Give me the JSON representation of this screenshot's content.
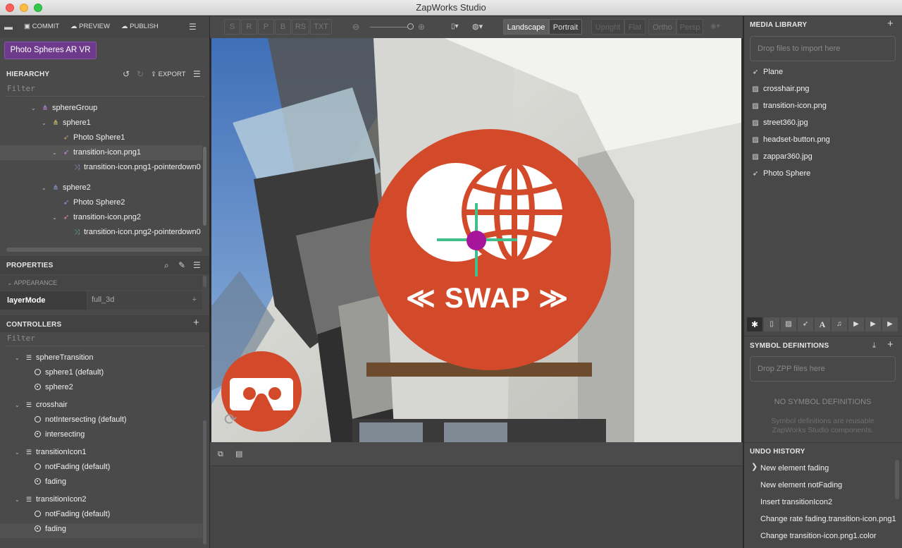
{
  "window": {
    "title": "ZapWorks Studio"
  },
  "topbar": {
    "commit": "COMMIT",
    "preview": "PREVIEW",
    "publish": "PUBLISH"
  },
  "project": {
    "name": "Photo Spheres AR VR"
  },
  "hierarchy": {
    "title": "HIERARCHY",
    "export": "EXPORT",
    "filter_placeholder": "Filter",
    "items": [
      {
        "label": "sphereGroup",
        "icon": "group-icon",
        "color": "#c78be0"
      },
      {
        "label": "sphere1",
        "icon": "group-icon",
        "color": "#e7d36a"
      },
      {
        "label": "Photo Sphere1",
        "icon": "rocket-icon",
        "color": "#b5a06a"
      },
      {
        "label": "transition-icon.png1",
        "icon": "rocket-icon",
        "color": "#c78be0"
      },
      {
        "label": "transition-icon.png1-pointerdown0",
        "icon": "shuffle-icon",
        "color": "#a78be0"
      },
      {
        "label": "sphere2",
        "icon": "group-icon",
        "color": "#8fa0d8"
      },
      {
        "label": "Photo Sphere2",
        "icon": "rocket-icon",
        "color": "#a88be0"
      },
      {
        "label": "transition-icon.png2",
        "icon": "rocket-icon",
        "color": "#e08b9a"
      },
      {
        "label": "transition-icon.png2-pointerdown0",
        "icon": "shuffle-icon",
        "color": "#5fbf7a"
      }
    ]
  },
  "properties": {
    "title": "PROPERTIES",
    "section": "APPEARANCE",
    "prop_name": "layerMode",
    "prop_value": "full_3d"
  },
  "controllers": {
    "title": "CONTROLLERS",
    "filter_placeholder": "Filter",
    "groups": [
      {
        "name": "sphereTransition",
        "states": [
          {
            "label": "sphere1 (default)",
            "on": false
          },
          {
            "label": "sphere2",
            "on": true
          }
        ]
      },
      {
        "name": "crosshair",
        "states": [
          {
            "label": "notIntersecting (default)",
            "on": false
          },
          {
            "label": "intersecting",
            "on": true
          }
        ]
      },
      {
        "name": "transitionIcon1",
        "states": [
          {
            "label": "notFading (default)",
            "on": false
          },
          {
            "label": "fading",
            "on": true
          }
        ]
      },
      {
        "name": "transitionIcon2",
        "states": [
          {
            "label": "notFading (default)",
            "on": false
          },
          {
            "label": "fading",
            "on": true
          }
        ]
      }
    ]
  },
  "toolbar": {
    "toggles": [
      "S",
      "R",
      "P",
      "B",
      "RS",
      "TXT"
    ],
    "landscape": "Landscape",
    "portrait": "Portrait",
    "upright": "Upright",
    "flat": "Flat",
    "ortho": "Ortho",
    "persp": "Persp"
  },
  "viewport": {
    "swap_label": "SWAP",
    "accent": "#d34a2b",
    "crosshair_color": "#3fbf8a",
    "dot_color": "#a6159a"
  },
  "media_library": {
    "title": "MEDIA LIBRARY",
    "drop_text": "Drop files to import here",
    "items": [
      {
        "label": "Plane",
        "icon": "rocket-icon"
      },
      {
        "label": "crosshair.png",
        "icon": "image-icon"
      },
      {
        "label": "transition-icon.png",
        "icon": "image-icon"
      },
      {
        "label": "street360.jpg",
        "icon": "image-icon"
      },
      {
        "label": "headset-button.png",
        "icon": "image-icon"
      },
      {
        "label": "zappar360.jpg",
        "icon": "image-icon"
      },
      {
        "label": "Photo Sphere",
        "icon": "rocket-icon"
      }
    ]
  },
  "symbols": {
    "title": "SYMBOL DEFINITIONS",
    "drop_text": "Drop ZPP files here",
    "empty_title": "NO SYMBOL DEFINITIONS",
    "empty_desc": "Symbol definitions are reusable ZapWorks Studio components."
  },
  "undo": {
    "title": "UNDO HISTORY",
    "items": [
      "New element fading",
      "New element notFading",
      "Insert transitionIcon2",
      "Change rate fading.transition-icon.png1",
      "Change transition-icon.png1.color"
    ]
  }
}
